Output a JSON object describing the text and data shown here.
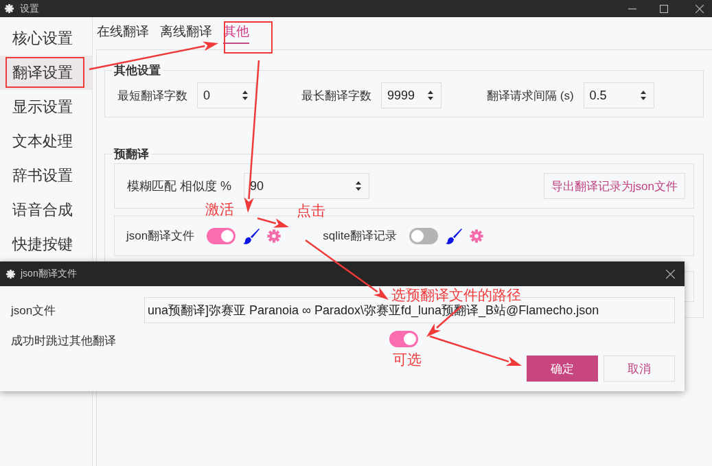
{
  "window": {
    "title": "设置"
  },
  "sidebar": {
    "items": [
      {
        "label": "核心设置",
        "selected": false
      },
      {
        "label": "翻译设置",
        "selected": true
      },
      {
        "label": "显示设置",
        "selected": false
      },
      {
        "label": "文本处理",
        "selected": false
      },
      {
        "label": "辞书设置",
        "selected": false
      },
      {
        "label": "语音合成",
        "selected": false
      },
      {
        "label": "快捷按键",
        "selected": false
      }
    ]
  },
  "tabs": [
    {
      "label": "在线翻译",
      "selected": false
    },
    {
      "label": "离线翻译",
      "selected": false
    },
    {
      "label": "其他",
      "selected": true
    }
  ],
  "other_settings": {
    "title": "其他设置",
    "fields": [
      {
        "label": "最短翻译字数",
        "value": "0"
      },
      {
        "label": "最长翻译字数",
        "value": "9999"
      },
      {
        "label": "翻译请求间隔 (s)",
        "value": "0.5"
      }
    ]
  },
  "pre_translation": {
    "title": "预翻译",
    "fuzzy": {
      "label": "模糊匹配 相似度 %",
      "value": "90"
    },
    "export_button": "导出翻译记录为json文件",
    "sources": [
      {
        "label": "json翻译文件",
        "on": true
      },
      {
        "label": "sqlite翻译记录",
        "on": false
      }
    ]
  },
  "dialog": {
    "title": "json翻译文件",
    "path_label": "json文件",
    "path_value": "una预翻译]弥赛亚 Paranoia ∞ Paradox\\弥赛亚fd_luna预翻译_B站@Flamecho.json",
    "skip_label": "成功时跳过其他翻译",
    "skip_on": true,
    "buttons": [
      {
        "label": "确定",
        "kind": "primary"
      },
      {
        "label": "取消",
        "kind": "secondary"
      }
    ]
  },
  "annotations": [
    "激活",
    "点击",
    "选预翻译文件的路径",
    "可选"
  ]
}
